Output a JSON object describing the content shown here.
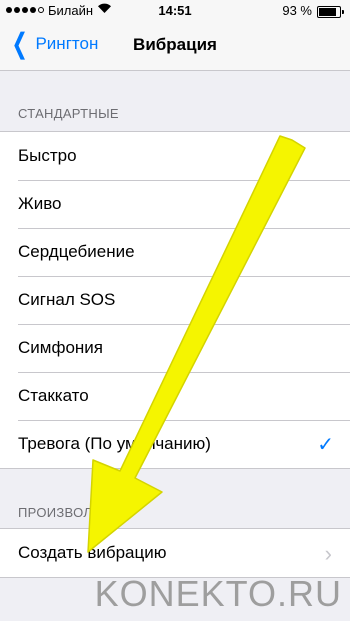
{
  "status_bar": {
    "carrier": "Билайн",
    "time": "14:51",
    "battery_percent": "93 %",
    "battery_level": 0.93,
    "signal_bars": 4
  },
  "nav": {
    "back_label": "Рингтон",
    "title": "Вибрация"
  },
  "sections": [
    {
      "header": "СТАНДАРТНЫЕ",
      "items": [
        {
          "label": "Быстро"
        },
        {
          "label": "Живо"
        },
        {
          "label": "Сердцебиение"
        },
        {
          "label": "Сигнал SOS"
        },
        {
          "label": "Симфония"
        },
        {
          "label": "Стаккато"
        },
        {
          "label": "Тревога (По умолчанию)",
          "selected": true
        }
      ]
    },
    {
      "header": "ПРОИЗВОЛЬНЫЕ",
      "items": [
        {
          "label": "Создать вибрацию",
          "disclosure": true
        }
      ]
    }
  ],
  "watermark": "KONEKTO.RU",
  "colors": {
    "accent": "#007aff",
    "arrow": "#f5f500"
  }
}
